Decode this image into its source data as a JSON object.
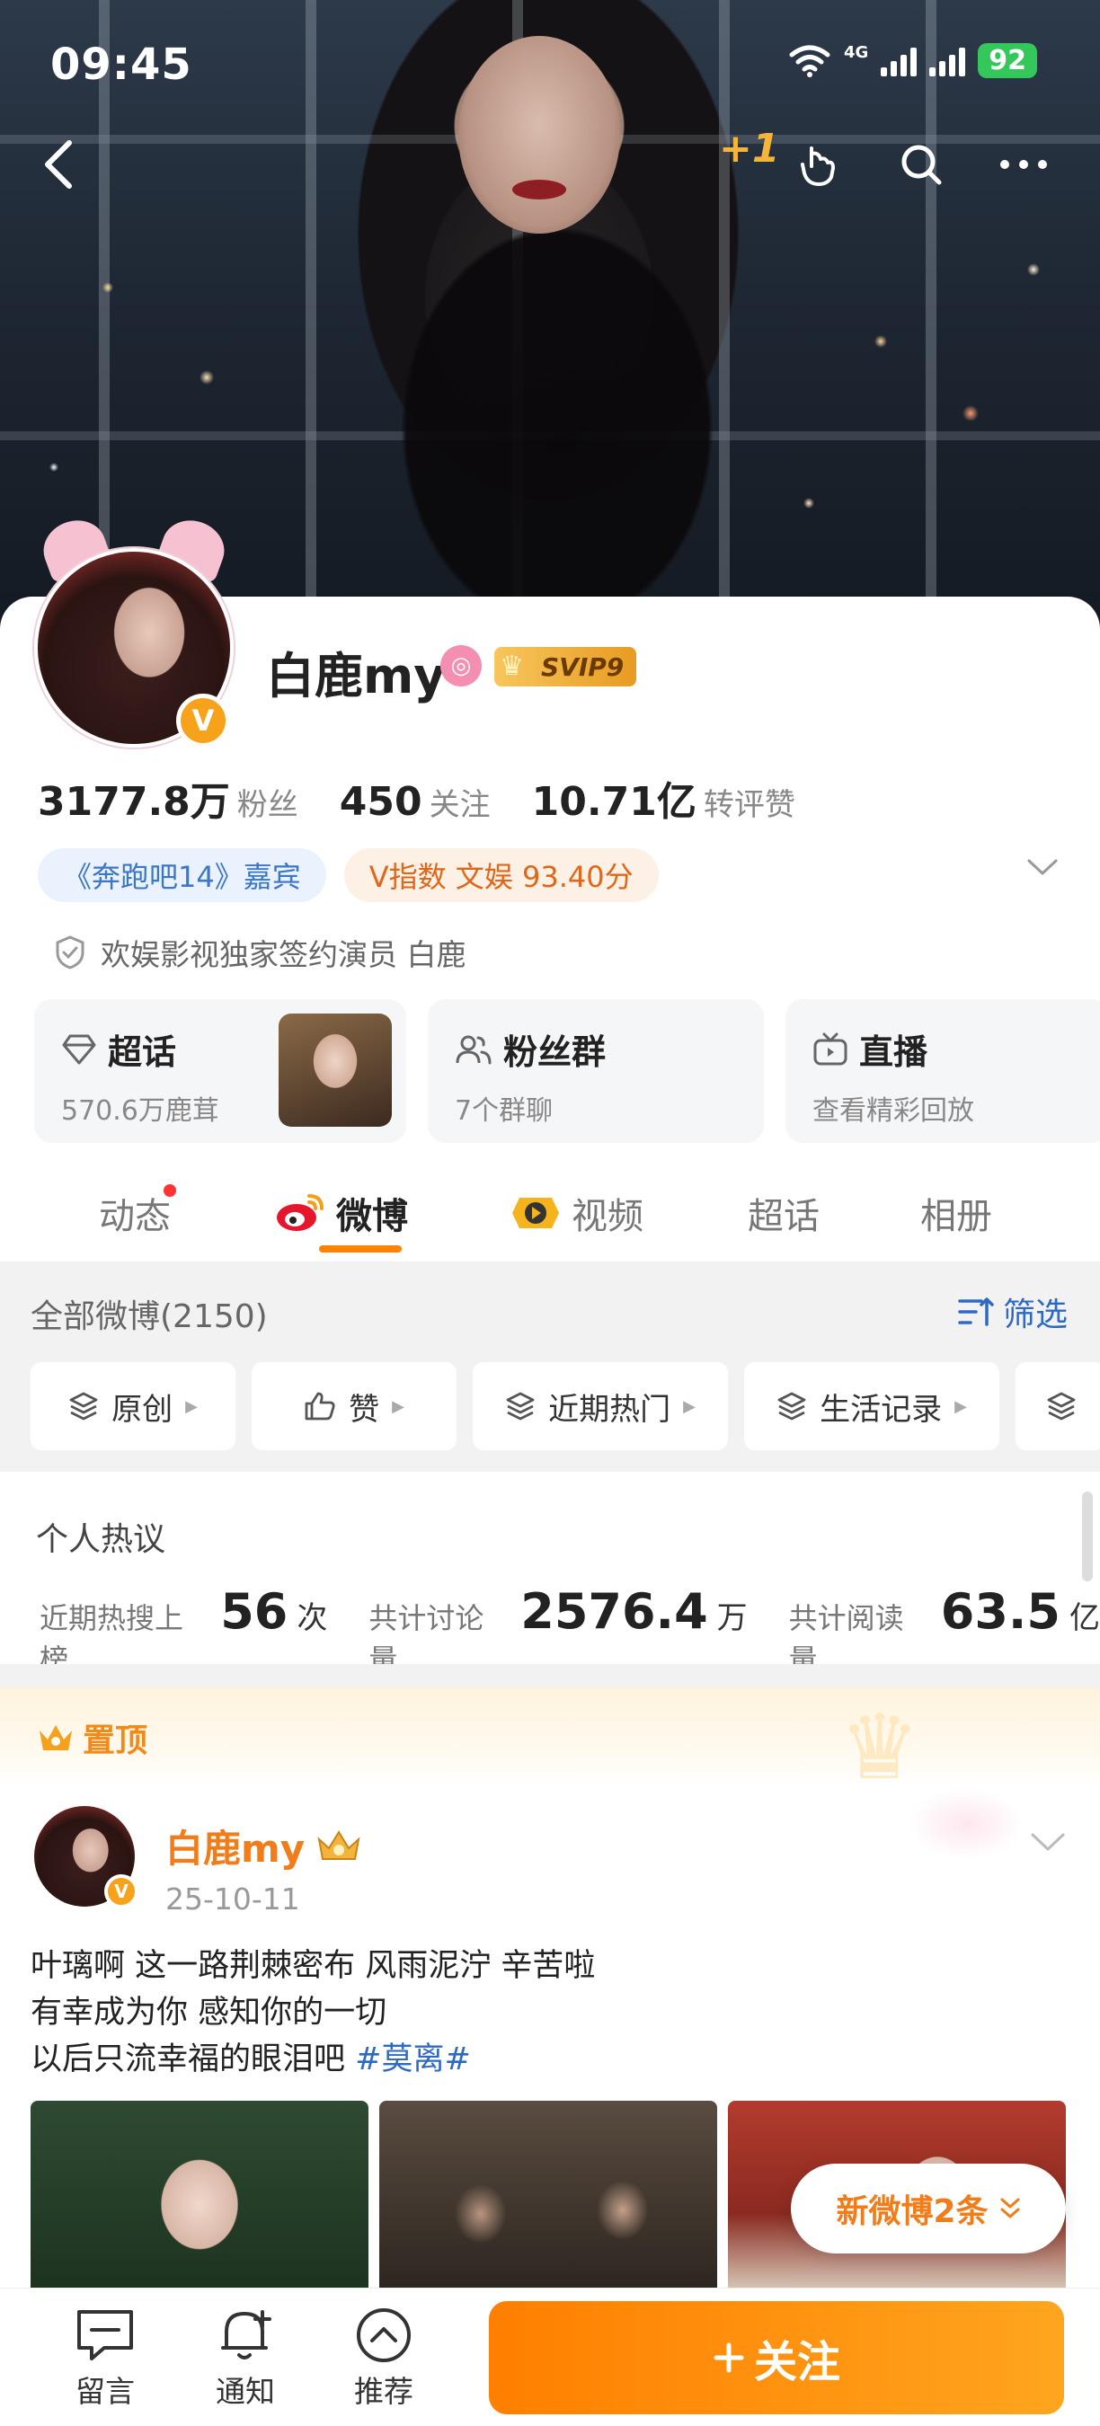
{
  "status_bar": {
    "time": "09:45",
    "network": "4G",
    "battery": "92"
  },
  "top_nav": {
    "plus_one": "+1"
  },
  "profile": {
    "name": "白鹿my",
    "svip": "SVIP9",
    "stats": [
      {
        "num": "3177.8万",
        "label": "粉丝"
      },
      {
        "num": "450",
        "label": "关注"
      },
      {
        "num": "10.71亿",
        "label": "转评赞"
      }
    ],
    "tags": [
      {
        "text": "《奔跑吧14》嘉宾"
      },
      {
        "text": "V指数 文娱 93.40分"
      }
    ],
    "verification": "欢娱影视独家签约演员 白鹿",
    "feature_cards": [
      {
        "title": "超话",
        "sub": "570.6万鹿茸",
        "icon": "diamond-icon"
      },
      {
        "title": "粉丝群",
        "sub": "7个群聊",
        "icon": "group-icon"
      },
      {
        "title": "直播",
        "sub": "查看精彩回放",
        "icon": "tv-icon"
      }
    ]
  },
  "tabs": [
    {
      "label": "动态"
    },
    {
      "label": "微博"
    },
    {
      "label": "视频"
    },
    {
      "label": "超话"
    },
    {
      "label": "相册"
    }
  ],
  "filters": {
    "all_count": "全部微博(2150)",
    "sift_label": "筛选",
    "chips": [
      {
        "label": "原创"
      },
      {
        "label": "赞"
      },
      {
        "label": "近期热门"
      },
      {
        "label": "生活记录"
      }
    ]
  },
  "personal_hot": {
    "title": "个人热议",
    "items": [
      {
        "label": "近期热搜上榜",
        "value": "56",
        "unit": "次"
      },
      {
        "label": "共计讨论量",
        "value": "2576.4",
        "unit": "万"
      },
      {
        "label": "共计阅读量",
        "value": "63.5",
        "unit": "亿"
      }
    ]
  },
  "pinned": {
    "banner": "置顶",
    "author": "白鹿my",
    "date": "25-10-11",
    "lines": [
      "叶璃啊 这一路荆棘密布 风雨泥泞 辛苦啦",
      "有幸成为你 感知你的一切",
      "以后只流幸福的眼泪吧 "
    ],
    "hashtag": "#莫离#"
  },
  "new_posts": "新微博2条",
  "bottom_bar": {
    "items": [
      {
        "label": "留言"
      },
      {
        "label": "通知"
      },
      {
        "label": "推荐"
      }
    ],
    "follow": "关注"
  },
  "colors": {
    "accent": "#ff8200",
    "link": "#2e6ac4",
    "orange_name": "#f07d1a"
  }
}
